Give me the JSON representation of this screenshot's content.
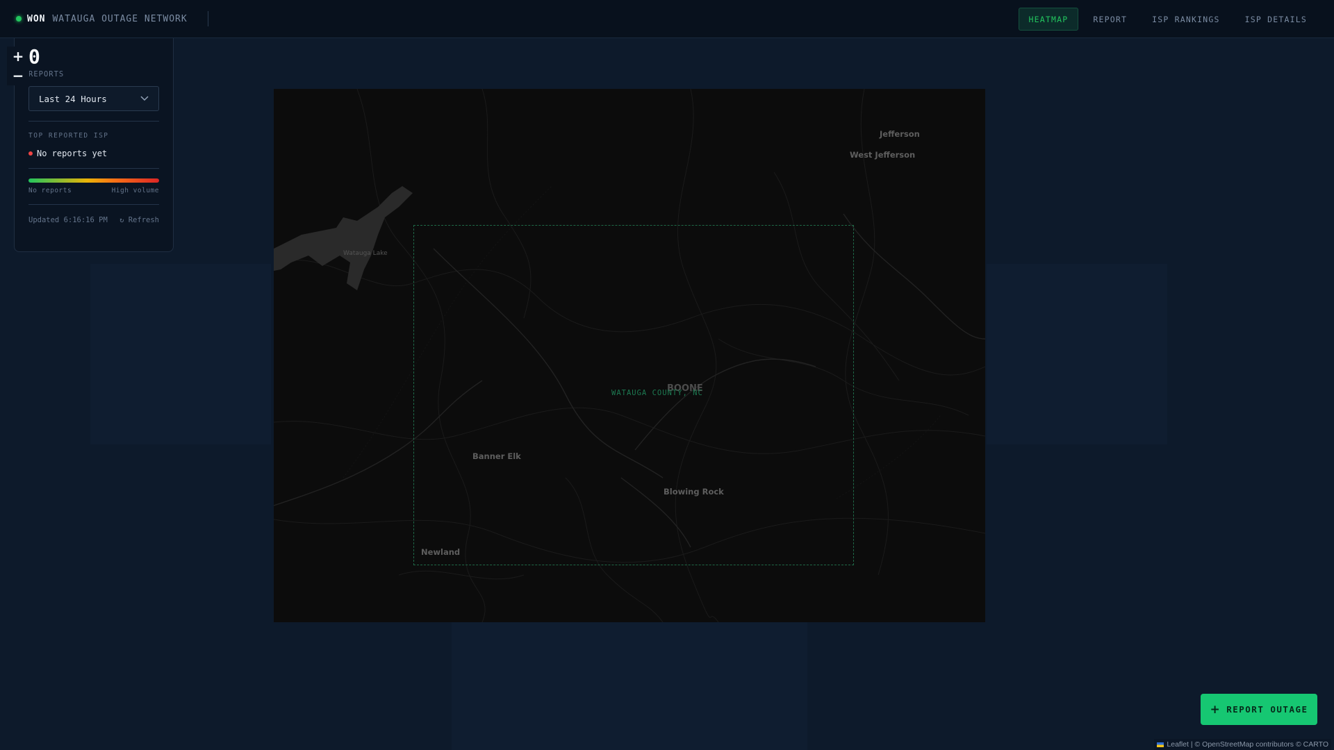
{
  "app": {
    "abbr": "WON",
    "name": "WATAUGA OUTAGE NETWORK"
  },
  "nav": {
    "items": [
      {
        "label": "HEATMAP",
        "active": true
      },
      {
        "label": "REPORT",
        "active": false
      },
      {
        "label": "ISP RANKINGS",
        "active": false
      },
      {
        "label": "ISP DETAILS",
        "active": false
      }
    ]
  },
  "zoom": {
    "in": "+",
    "out": "−"
  },
  "stats": {
    "count": "0",
    "count_label": "REPORTS",
    "time_range": "Last 24 Hours",
    "top_isp_title": "TOP REPORTED ISP",
    "top_isp_value": "No reports yet",
    "legend_low": "No reports",
    "legend_high": "High volume",
    "updated": "Updated 6:16:16 PM",
    "refresh": "↻ Refresh"
  },
  "map": {
    "places": {
      "jefferson": "Jefferson",
      "west_jefferson": "West Jefferson",
      "watauga_lake": "Watauga Lake",
      "boone": "BOONE",
      "banner_elk": "Banner Elk",
      "blowing_rock": "Blowing Rock",
      "newland": "Newland"
    },
    "county_label": "WATAUGA COUNTY, NC"
  },
  "report_button": {
    "label": "REPORT OUTAGE"
  },
  "attribution": "Leaflet | © OpenStreetMap contributors © CARTO",
  "colors": {
    "accent": "#22c55e",
    "report_button": "#16c772",
    "status_dot": "#ef4444"
  }
}
